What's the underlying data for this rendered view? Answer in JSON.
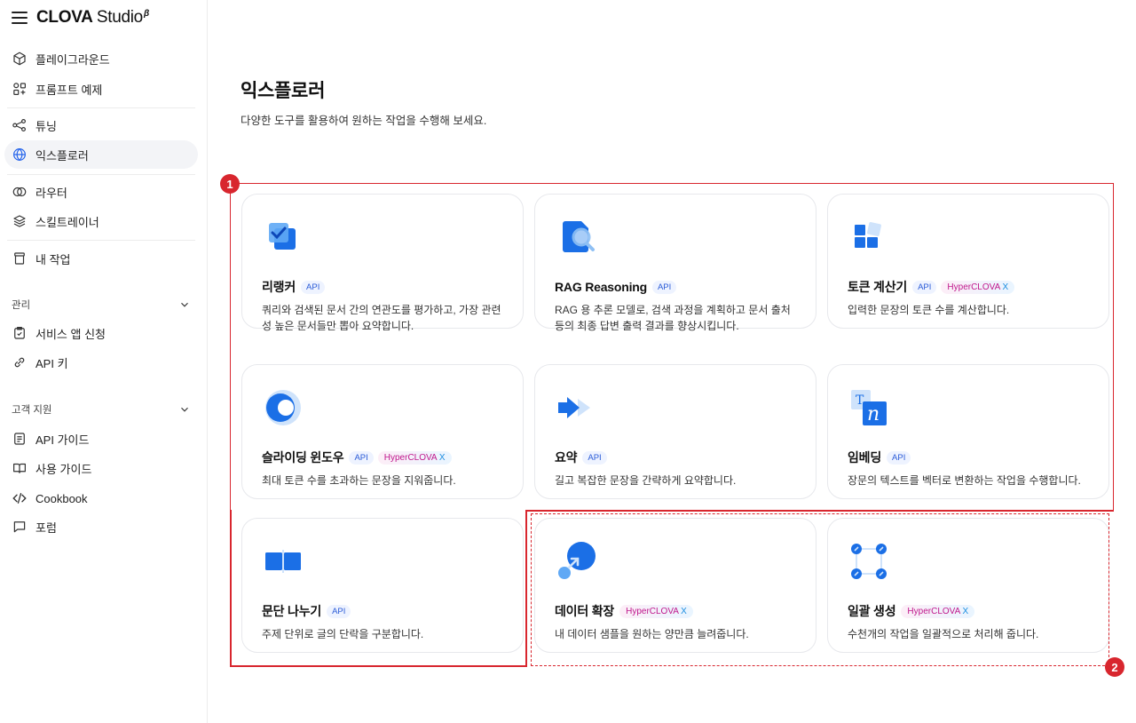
{
  "brand": {
    "name": "CLOVA",
    "suffix": "Studio",
    "sup": "β"
  },
  "sidebar": {
    "items": [
      {
        "label": "플레이그라운드",
        "icon": "cube-icon"
      },
      {
        "label": "프롬프트 예제",
        "icon": "grid-shapes-icon"
      },
      {
        "label": "튜닝",
        "icon": "nodes-icon"
      },
      {
        "label": "익스플로러",
        "icon": "globe-icon",
        "active": true
      },
      {
        "label": "라우터",
        "icon": "circles-icon"
      },
      {
        "label": "스킬트레이너",
        "icon": "layers-icon"
      },
      {
        "label": "내 작업",
        "icon": "jar-icon"
      }
    ],
    "sections": [
      {
        "label": "관리",
        "items": [
          {
            "label": "서비스 앱 신청",
            "icon": "checklist-icon"
          },
          {
            "label": "API 키",
            "icon": "link-icon"
          }
        ]
      },
      {
        "label": "고객 지원",
        "items": [
          {
            "label": "API 가이드",
            "icon": "document-icon"
          },
          {
            "label": "사용 가이드",
            "icon": "book-icon"
          },
          {
            "label": "Cookbook",
            "icon": "code-icon"
          },
          {
            "label": "포럼",
            "icon": "chat-icon"
          }
        ]
      }
    ]
  },
  "main": {
    "title": "익스플로러",
    "subtitle": "다양한 도구를 활용하여 원하는 작업을 수행해 보세요.",
    "badges": {
      "api": "API",
      "hcx_main": "HyperCLOVA",
      "hcx_x": "X"
    },
    "cards": [
      {
        "title": "리랭커",
        "api": true,
        "hcx": false,
        "desc": "쿼리와 검색된 문서 간의 연관도를 평가하고, 가장 관련성 높은 문서들만 뽑아 요약합니다."
      },
      {
        "title": "RAG Reasoning",
        "api": true,
        "hcx": false,
        "desc": "RAG 용 추론 모델로, 검색 과정을 계획하고 문서 출처 등의 최종 답변 출력 결과를 향상시킵니다."
      },
      {
        "title": "토큰 계산기",
        "api": true,
        "hcx": true,
        "desc": "입력한 문장의 토큰 수를 계산합니다."
      },
      {
        "title": "슬라이딩 윈도우",
        "api": true,
        "hcx": true,
        "desc": "최대 토큰 수를 초과하는 문장을 지워줍니다."
      },
      {
        "title": "요약",
        "api": true,
        "hcx": false,
        "desc": "길고 복잡한 문장을 간략하게 요약합니다."
      },
      {
        "title": "임베딩",
        "api": true,
        "hcx": false,
        "desc": "장문의 텍스트를 벡터로 변환하는 작업을 수행합니다."
      },
      {
        "title": "문단 나누기",
        "api": true,
        "hcx": false,
        "desc": "주제 단위로 글의 단락을 구분합니다."
      },
      {
        "title": "데이터 확장",
        "api": false,
        "hcx": true,
        "desc": "내 데이터 샘플을 원하는 양만큼 늘려줍니다."
      },
      {
        "title": "일괄 생성",
        "api": false,
        "hcx": true,
        "desc": "수천개의 작업을 일괄적으로 처리해 줍니다."
      }
    ]
  },
  "annotations": {
    "marker1": "1",
    "marker2": "2",
    "color": "#d8262e"
  }
}
